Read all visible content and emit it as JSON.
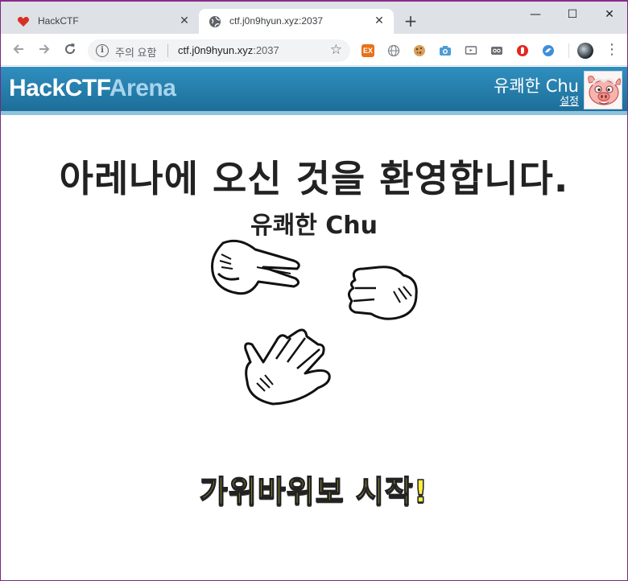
{
  "browser": {
    "tabs": [
      {
        "title": "HackCTF",
        "icon": "heart-icon",
        "active": false
      },
      {
        "title": "ctf.j0n9hyun.xyz:2037",
        "icon": "globe-icon",
        "active": true
      }
    ],
    "new_tab_label": "+",
    "window_controls": {
      "minimize": "—",
      "maximize": "☐",
      "close": "✕"
    },
    "security_warning": "주의 요함",
    "url_host": "ctf.j0n9hyun.xyz",
    "url_port": ":2037",
    "extensions": [
      "ex-icon",
      "globe-icon",
      "cookie-icon",
      "camera-icon",
      "screen-icon",
      "eyes-icon",
      "stop-icon",
      "bird-icon"
    ]
  },
  "header": {
    "brand_primary": "HackCTF",
    "brand_secondary": "Arena",
    "username": "유쾌한 Chu",
    "settings_link": "설정",
    "accent_color": "#2a88b8"
  },
  "main": {
    "welcome_text": "아레나에 오신 것을 환영합니다.",
    "player_name": "유쾌한 Chu",
    "hands": [
      "scissors-hand",
      "rock-hand",
      "paper-hand"
    ],
    "start_text": "가위바위보 시작!"
  }
}
